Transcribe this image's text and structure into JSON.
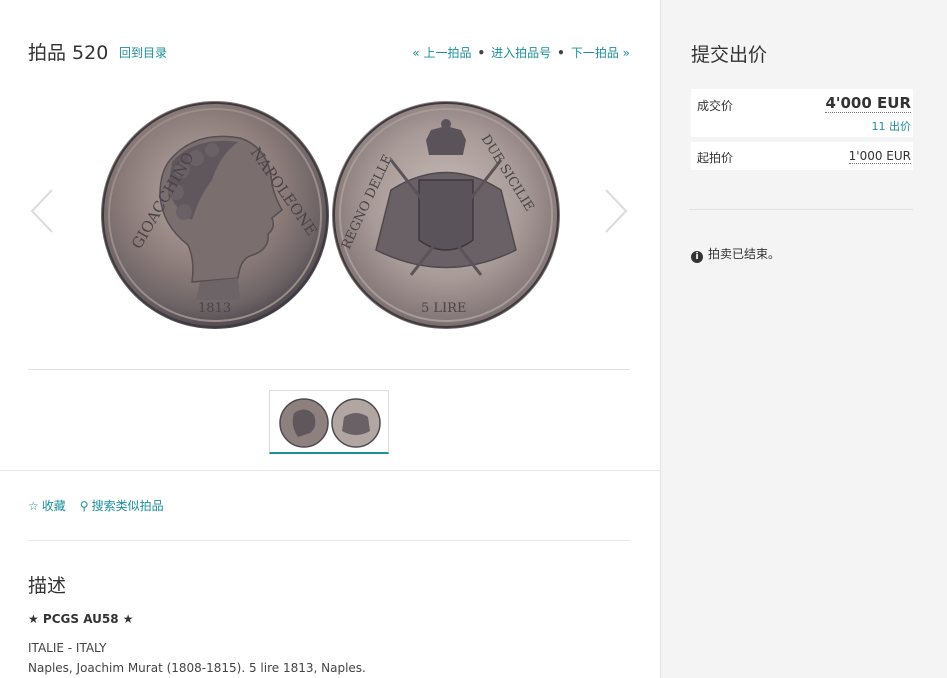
{
  "lot": {
    "title": "拍品 520",
    "back_link": "回到目录",
    "nav": {
      "prev": "« 上一拍品",
      "jump": "进入拍品号",
      "next": "下一拍品 »"
    }
  },
  "actions": {
    "favorite": "收藏",
    "search_similar": "搜索类似拍品"
  },
  "description": {
    "title": "描述",
    "grade": "★ PCGS AU58 ★",
    "country": "ITALIE - ITALY",
    "coin_line": "Naples, Joachim Murat (1808-1815). 5 lire 1813, Naples."
  },
  "bid_panel": {
    "title": "提交出价",
    "hammer_label": "成交价",
    "hammer_value": "4'000 EUR",
    "bid_count": "11 出价",
    "start_label": "起拍价",
    "start_value": "1'000 EUR",
    "status": "拍卖已结束。"
  },
  "icons": {
    "star": "star-icon",
    "search": "search-icon",
    "info": "info-icon",
    "prev_arrow": "chevron-left-icon",
    "next_arrow": "chevron-right-icon"
  },
  "colors": {
    "accent": "#1c8f9b",
    "sidebar_bg": "#f4f4f4"
  }
}
